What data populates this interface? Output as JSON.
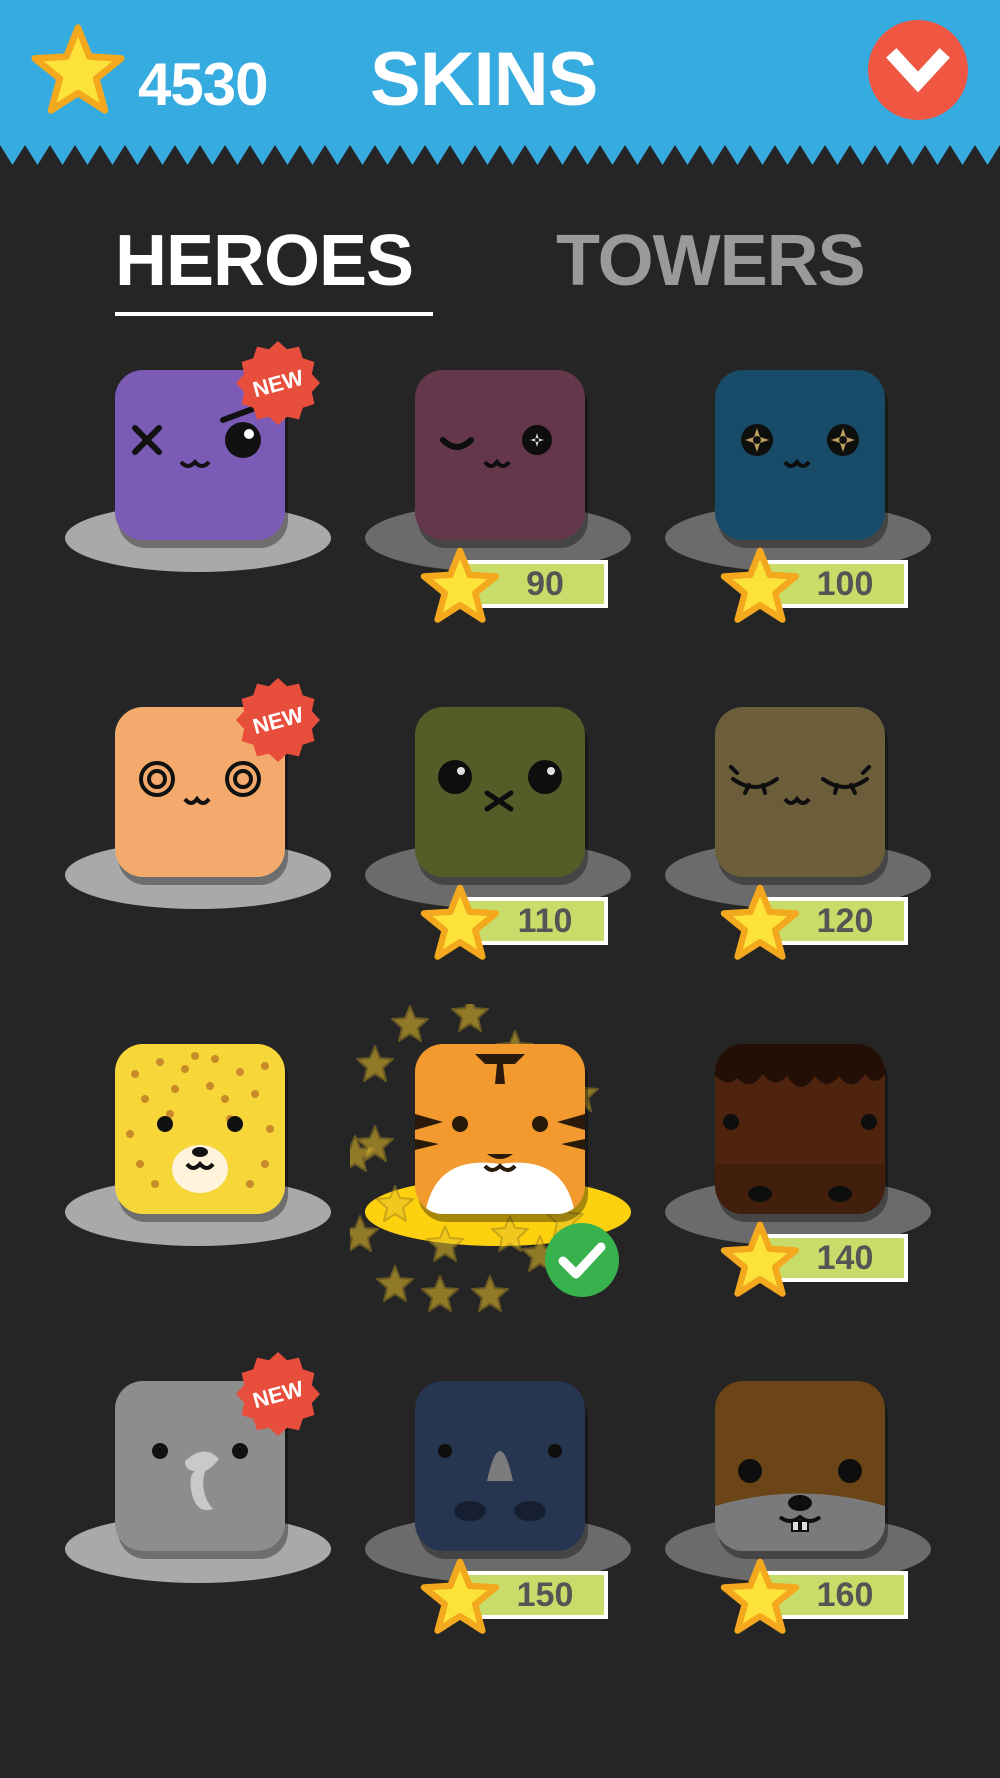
{
  "header": {
    "coin_count": "4530",
    "title": "SKINS",
    "close_icon": "chevron-down-icon"
  },
  "tabs": [
    {
      "label": "HEROES",
      "active": true
    },
    {
      "label": "TOWERS",
      "active": false
    }
  ],
  "badge_text": "NEW",
  "colors": {
    "header_bg": "#35abe0",
    "background": "#252526",
    "price_bg": "#c8dc6a",
    "close_button": "#ef5743",
    "selected_check": "#37b24d",
    "star": "#fde23a"
  },
  "skins": [
    {
      "name": "purple-hero",
      "color": "#7b5bb6",
      "badge": "NEW",
      "price": null,
      "state": "owned"
    },
    {
      "name": "maroon-hero",
      "color": "#723f55",
      "badge": null,
      "price": "90",
      "state": "locked"
    },
    {
      "name": "teal-hero",
      "color": "#1b5676",
      "badge": null,
      "price": "100",
      "state": "locked"
    },
    {
      "name": "orange-hero",
      "color": "#f4aa6c",
      "badge": "NEW",
      "price": null,
      "state": "owned"
    },
    {
      "name": "green-hero",
      "color": "#5f6a2e",
      "badge": null,
      "price": "110",
      "state": "locked"
    },
    {
      "name": "khaki-hero",
      "color": "#7b6a44",
      "badge": null,
      "price": "120",
      "state": "locked"
    },
    {
      "name": "leopard-hero",
      "color": "#f7d63a",
      "badge": null,
      "price": null,
      "state": "owned"
    },
    {
      "name": "tiger-hero",
      "color": "#f29a2e",
      "badge": null,
      "price": null,
      "state": "selected"
    },
    {
      "name": "cake-hero",
      "color": "#5a2a12",
      "badge": null,
      "price": "140",
      "state": "locked"
    },
    {
      "name": "elephant-hero",
      "color": "#8d8d8d",
      "badge": "NEW",
      "price": null,
      "state": "owned"
    },
    {
      "name": "rhino-hero",
      "color": "#2d3e5c",
      "badge": null,
      "price": "150",
      "state": "locked"
    },
    {
      "name": "beaver-hero",
      "color": "#7a4e1c",
      "badge": null,
      "price": "160",
      "state": "locked"
    }
  ]
}
